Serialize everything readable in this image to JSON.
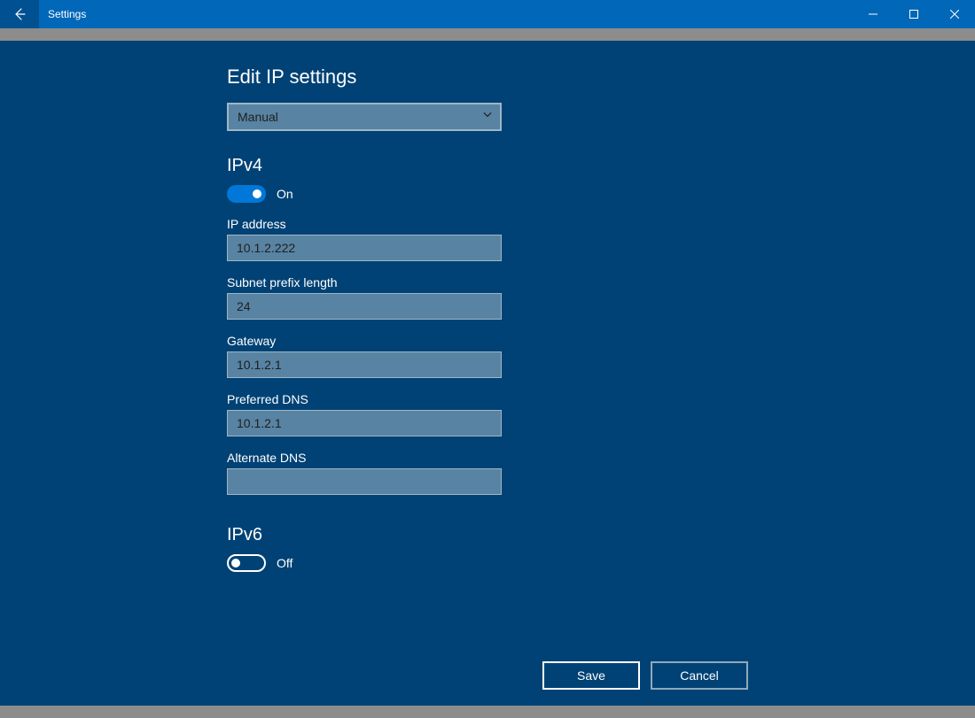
{
  "window": {
    "title": "Settings"
  },
  "page": {
    "heading": "Edit IP settings"
  },
  "dropdown": {
    "selected": "Manual"
  },
  "ipv4": {
    "heading": "IPv4",
    "toggle_state": "On",
    "fields": {
      "ip_label": "IP address",
      "ip_value": "10.1.2.222",
      "subnet_label": "Subnet prefix length",
      "subnet_value": "24",
      "gateway_label": "Gateway",
      "gateway_value": "10.1.2.1",
      "pref_dns_label": "Preferred DNS",
      "pref_dns_value": "10.1.2.1",
      "alt_dns_label": "Alternate DNS",
      "alt_dns_value": ""
    }
  },
  "ipv6": {
    "heading": "IPv6",
    "toggle_state": "Off"
  },
  "buttons": {
    "save": "Save",
    "cancel": "Cancel"
  }
}
